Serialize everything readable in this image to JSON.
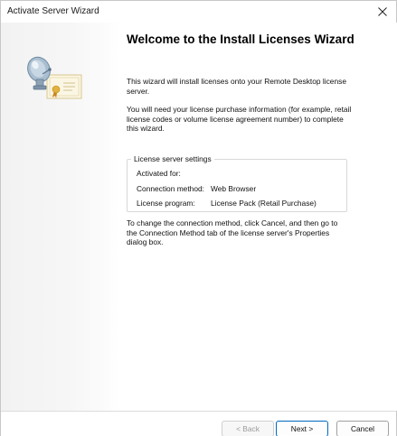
{
  "window": {
    "title": "Activate Server Wizard"
  },
  "heading": "Welcome to the Install Licenses Wizard",
  "intro": "This wizard will install licenses onto your Remote Desktop license server.",
  "info": "You will need your license purchase information (for example, retail license codes or volume license agreement number) to complete this wizard.",
  "settings": {
    "legend": "License server settings",
    "activated_for_label": "Activated for:",
    "activated_for_value": "",
    "connection_method_label": "Connection method:",
    "connection_method_value": "Web Browser",
    "license_program_label": "License program:",
    "license_program_value": "License Pack (Retail Purchase)"
  },
  "change_note": "To change the connection method, click Cancel, and then go to the Connection Method tab of the license server's Properties dialog box.",
  "buttons": {
    "back": "< Back",
    "next": "Next >",
    "cancel": "Cancel"
  },
  "icons": {
    "close": "close-icon",
    "wizard_art": "server-certificate-icon"
  }
}
